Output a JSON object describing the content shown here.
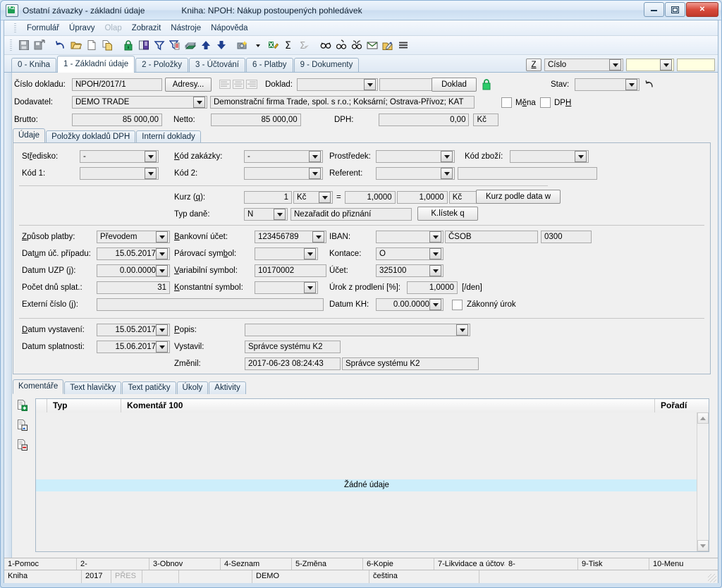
{
  "window": {
    "title": "Ostatní závazky - základní údaje",
    "book_label": "Kniha: NPOH: Nákup postoupených pohledávek",
    "app_icon": "k2-app-icon",
    "minimize_label": "Minimalizovat",
    "maximize_label": "Maximalizovat",
    "close_label": "Zavřít"
  },
  "menu": {
    "items": [
      {
        "label": "Formulář",
        "disabled": false
      },
      {
        "label": "Úpravy",
        "disabled": false
      },
      {
        "label": "Olap",
        "disabled": true
      },
      {
        "label": "Zobrazit",
        "disabled": false
      },
      {
        "label": "Nástroje",
        "disabled": false
      },
      {
        "label": "Nápověda",
        "disabled": false
      }
    ]
  },
  "toolbar": {
    "icons": [
      "save-icon",
      "save-as-icon",
      "undo-icon",
      "open-folder-icon",
      "new-document-icon",
      "copy-document-icon",
      "lock-icon",
      "book-icon",
      "filter-icon",
      "filter-list-icon",
      "print-icon",
      "move-up-icon",
      "move-down-icon",
      "camera-icon",
      "dropdown-arrow-icon",
      "export-excel-icon",
      "sum-icon",
      "sum-disabled-icon",
      "find-icon",
      "find-next-icon",
      "find-all-icon",
      "mail-icon",
      "edit-note-icon",
      "menu-lines-icon"
    ]
  },
  "tabs": {
    "items": [
      {
        "label": "0 - Kniha",
        "active": false
      },
      {
        "label": "1 - Základní údaje",
        "active": true
      },
      {
        "label": "2 - Položky",
        "active": false
      },
      {
        "label": "3 - Účtování",
        "active": false
      },
      {
        "label": "6 - Platby",
        "active": false
      },
      {
        "label": "9 - Dokumenty",
        "active": false
      }
    ],
    "z_button": "Z",
    "search_field": "Číslo",
    "search_value": "",
    "search_value2": ""
  },
  "header": {
    "cislo_dokladu_label": "Číslo dokladu:",
    "cislo_dokladu_value": "NPOH/2017/1",
    "adresy_button": "Adresy...",
    "doklad_label": "Doklad:",
    "doklad_value": "",
    "doklad_value2": "",
    "doklad_button": "Doklad",
    "lock_icon": "lock-green-icon",
    "stav_label": "Stav:",
    "stav_value": "",
    "history_icon": "history-undo-icon",
    "dodavatel_label": "Dodavatel:",
    "dodavatel_value": "DEMO TRADE",
    "dodavatel_desc": "Demonstrační firma Trade, spol. s r.o.; Koksární; Ostrava-Přívoz; KAT",
    "mena_label": "Měna",
    "mena_checked": false,
    "dph_label": "DPH",
    "dph_checked": false,
    "brutto_label": "Brutto:",
    "brutto_value": "85 000,00",
    "netto_label": "Netto:",
    "netto_value": "85 000,00",
    "dph_amount_label": "DPH:",
    "dph_amount_value": "0,00",
    "currency": "Kč"
  },
  "subtabs": {
    "items": [
      {
        "label": "Údaje",
        "active": true
      },
      {
        "label": "Položky dokladů DPH",
        "active": false
      },
      {
        "label": "Interní doklady",
        "active": false
      }
    ]
  },
  "form": {
    "stredisko_label": "Středisko:",
    "stredisko_value": "-",
    "kod_zakazky_label": "Kód zakázky:",
    "kod_zakazky_value": "-",
    "prostredek_label": "Prostředek:",
    "prostredek_value": "",
    "kod_zbozi_label": "Kód zboží:",
    "kod_zbozi_value": "",
    "kod1_label": "Kód 1:",
    "kod1_value": "",
    "kod2_label": "Kód 2:",
    "kod2_value": "",
    "referent_label": "Referent:",
    "referent_value": "",
    "referent_desc": "",
    "kurz_label": "Kurz (q):",
    "kurz_label_plain": "Kurz (",
    "kurz_accel": "q",
    "kurz_value": "1",
    "kurz_currency": "Kč",
    "kurz_equals": "=",
    "kurz_rate1": "1,0000",
    "kurz_rate2": "1,0000",
    "kurz_currency2": "Kč",
    "kurz_button": "Kurz podle data w",
    "typ_dane_label": "Typ daně:",
    "typ_dane_value": "N",
    "typ_dane_desc": "Nezařadit do přiznání",
    "klistek_button": "K.lístek q",
    "zpusob_platby_label": "Způsob platby:",
    "zpusob_platby_value": "Převodem",
    "bankovni_ucet_label": "Bankovní účet:",
    "bankovni_ucet_value": "123456789",
    "iban_label": "IBAN:",
    "iban_value": "",
    "iban_bank": "ČSOB",
    "iban_code": "0300",
    "datum_uc_pripadu_label": "Datum úč. případu:",
    "datum_uc_pripadu_value": "15.05.2017",
    "parovaci_symbol_label": "Párovací symbol:",
    "parovaci_symbol_value": "",
    "kontace_label": "Kontace:",
    "kontace_value": "O",
    "datum_uzp_label": "Datum UZP (j):",
    "datum_uzp_value": "0.00.0000",
    "variabilni_symbol_label": "Variabilní symbol:",
    "variabilni_symbol_value": "10170002",
    "ucet_label": "Účet:",
    "ucet_value": "325100",
    "pocet_dnu_splat_label": "Počet dnů splat.:",
    "pocet_dnu_splat_value": "31",
    "konstantni_symbol_label": "Konstantní symbol:",
    "konstantni_symbol_value": "",
    "urok_z_prodleni_label": "Úrok z prodlení [%]:",
    "urok_z_prodleni_value": "1,0000",
    "urok_unit": "[/den]",
    "externi_cislo_label": "Externí číslo (j):",
    "externi_cislo_value": "",
    "datum_kh_label": "Datum KH:",
    "datum_kh_value": "0.00.0000",
    "zakonny_urok_label": "Zákonný úrok",
    "zakonny_urok_checked": false,
    "datum_vystaveni_label": "Datum vystavení:",
    "datum_vystaveni_value": "15.05.2017",
    "popis_label": "Popis:",
    "popis_value": "",
    "datum_splatnosti_label": "Datum splatnosti:",
    "datum_splatnosti_value": "15.06.2017",
    "vystavil_label": "Vystavil:",
    "vystavil_value": "Správce systému K2",
    "zmenil_label": "Změnil:",
    "zmenil_datetime": "2017-06-23 08:24:43",
    "zmenil_value": "Správce systému K2"
  },
  "bottom": {
    "tabs": [
      {
        "label": "Komentáře",
        "active": true
      },
      {
        "label": "Text hlavičky",
        "active": false
      },
      {
        "label": "Text patičky",
        "active": false
      },
      {
        "label": "Úkoly",
        "active": false
      },
      {
        "label": "Aktivity",
        "active": false
      }
    ],
    "side_icons": [
      "add-document-icon",
      "edit-document-icon",
      "delete-document-icon"
    ],
    "grid": {
      "columns": [
        "",
        "Typ",
        "Komentář 100",
        "Pořadí"
      ],
      "empty_text": "Žádné údaje",
      "rows": []
    }
  },
  "fkeys": [
    "1-Pomoc",
    "2-",
    "3-Obnov",
    "4-Seznam",
    "5-Změna",
    "6-Kopie",
    "7-Likvidace a účtová",
    "8-",
    "9-Tisk",
    "10-Menu"
  ],
  "status": {
    "book": "Kniha",
    "year": "2017",
    "mode": "PŘES",
    "blank1": "",
    "blank2": "",
    "company": "DEMO",
    "language": "čeština",
    "blank3": ""
  },
  "colors": {
    "accent_blue": "#1a5fa8",
    "title_gradient_top": "#eef5fc",
    "close_red": "#c0392b",
    "lock_green": "#1e9e54",
    "empty_row_blue": "#cdeefb",
    "field_gray": "#ececec",
    "yellow_field": "#ffffe1"
  }
}
